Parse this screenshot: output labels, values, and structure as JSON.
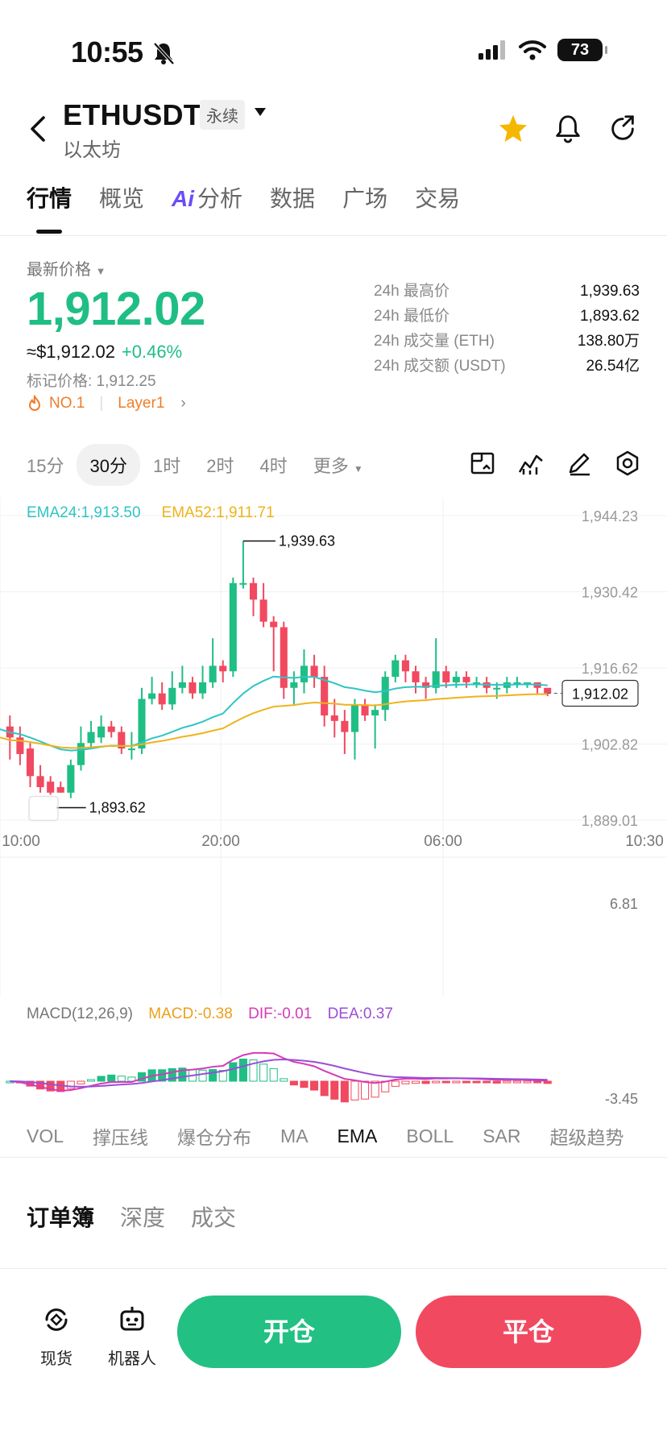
{
  "status": {
    "time": "10:55",
    "battery": "73"
  },
  "header": {
    "symbol": "ETHUSDT",
    "contract_type": "永续",
    "name": "以太坊"
  },
  "tabs": [
    "行情",
    "概览",
    "分析",
    "数据",
    "广场",
    "交易"
  ],
  "ai_badge": "Ai",
  "price": {
    "label": "最新价格",
    "last": "1,912.02",
    "usd": "≈$1,912.02",
    "change": "+0.46%",
    "mark_price": "标记价格: 1,912.25",
    "rank": "NO.1",
    "tag": "Layer1"
  },
  "stats": [
    {
      "label": "24h 最高价",
      "value": "1,939.63"
    },
    {
      "label": "24h 最低价",
      "value": "1,893.62"
    },
    {
      "label": "24h 成交量 (ETH)",
      "value": "138.80万"
    },
    {
      "label": "24h 成交额 (USDT)",
      "value": "26.54亿"
    }
  ],
  "timeframes": [
    "15分",
    "30分",
    "1时",
    "2时",
    "4时",
    "更多"
  ],
  "active_timeframe": "30分",
  "chart": {
    "ema24_label": "EMA24:1,913.50",
    "ema52_label": "EMA52:1,911.71",
    "y_ticks": [
      "1,944.23",
      "1,930.42",
      "1,916.62",
      "1,902.82",
      "1,889.01"
    ],
    "x_ticks": [
      "10:00",
      "20:00",
      "06:00",
      "10:30"
    ],
    "high_label": "1,939.63",
    "low_label": "1,893.62",
    "last_label": "1,912.02",
    "macd_params": "MACD(12,26,9)",
    "macd_value": "MACD:-0.38",
    "dif_value": "DIF:-0.01",
    "dea_value": "DEA:0.37",
    "macd_top": "6.81",
    "macd_bottom": "-3.45",
    "colors": {
      "up": "#1fbe85",
      "down": "#f1495f",
      "ema24": "#2ec5c4",
      "ema52": "#efb31b",
      "dif": "#d63ab8",
      "dea": "#9b4ed6"
    }
  },
  "chart_data": {
    "type": "candlestick",
    "ylim": [
      1889.01,
      1944.23
    ],
    "candles": [
      [
        1906,
        1904,
        1908,
        1900
      ],
      [
        1904,
        1901,
        1906,
        1899
      ],
      [
        1902,
        1897,
        1903,
        1895
      ],
      [
        1897,
        1895,
        1899,
        1894
      ],
      [
        1896,
        1894,
        1897,
        1893.62
      ],
      [
        1895,
        1894,
        1896,
        1894
      ],
      [
        1894,
        1899,
        1900,
        1893
      ],
      [
        1899,
        1903,
        1906,
        1898
      ],
      [
        1903,
        1905,
        1907,
        1902
      ],
      [
        1904,
        1906,
        1908,
        1903
      ],
      [
        1906,
        1905,
        1907,
        1904
      ],
      [
        1905,
        1902,
        1906,
        1901
      ],
      [
        1902,
        1902,
        1905,
        1900
      ],
      [
        1902,
        1911,
        1913,
        1901
      ],
      [
        1911,
        1912,
        1915,
        1910
      ],
      [
        1912,
        1910,
        1914,
        1909
      ],
      [
        1910,
        1913,
        1916,
        1909
      ],
      [
        1913,
        1914,
        1917,
        1912
      ],
      [
        1914,
        1912,
        1915,
        1911
      ],
      [
        1912,
        1914,
        1917,
        1911
      ],
      [
        1914,
        1917,
        1922,
        1913
      ],
      [
        1917,
        1916,
        1918,
        1914
      ],
      [
        1916,
        1932,
        1933,
        1915
      ],
      [
        1932,
        1932,
        1939.63,
        1931
      ],
      [
        1932,
        1929,
        1933,
        1926
      ],
      [
        1929,
        1925,
        1932,
        1924
      ],
      [
        1925,
        1924,
        1926,
        1916
      ],
      [
        1924,
        1913,
        1925,
        1911
      ],
      [
        1913,
        1914,
        1916,
        1910
      ],
      [
        1914,
        1917,
        1920,
        1912
      ],
      [
        1917,
        1915,
        1919,
        1913
      ],
      [
        1915,
        1908,
        1917,
        1906
      ],
      [
        1908,
        1907,
        1911,
        1904
      ],
      [
        1907,
        1905,
        1909,
        1901
      ],
      [
        1905,
        1910,
        1911,
        1900
      ],
      [
        1910,
        1908,
        1911,
        1907
      ],
      [
        1908,
        1909,
        1910,
        1902
      ],
      [
        1909,
        1915,
        1916,
        1907
      ],
      [
        1915,
        1918,
        1919,
        1914
      ],
      [
        1918,
        1916,
        1919,
        1914
      ],
      [
        1916,
        1914,
        1917,
        1912
      ],
      [
        1914,
        1913,
        1915,
        1911
      ],
      [
        1913,
        1916,
        1922,
        1912
      ],
      [
        1916,
        1914,
        1917,
        1913
      ],
      [
        1914,
        1915,
        1916,
        1913
      ],
      [
        1915,
        1914,
        1916,
        1913
      ],
      [
        1914,
        1914,
        1915,
        1913
      ],
      [
        1914,
        1913,
        1915,
        1912
      ],
      [
        1913,
        1913,
        1914,
        1911
      ],
      [
        1913,
        1914,
        1915,
        1912
      ],
      [
        1914,
        1914,
        1915,
        1913
      ],
      [
        1914,
        1914,
        1914,
        1913
      ],
      [
        1914,
        1913,
        1914,
        1912
      ],
      [
        1913,
        1912.02,
        1913,
        1911.5
      ]
    ],
    "macd_ylim": [
      -3.45,
      6.81
    ]
  },
  "indicators": [
    "VOL",
    "撑压线",
    "爆仓分布",
    "MA",
    "EMA",
    "BOLL",
    "SAR",
    "超级趋势"
  ],
  "active_indicator": "EMA",
  "book_tabs": [
    "订单簿",
    "深度",
    "成交"
  ],
  "bottom": {
    "spot": "现货",
    "bot": "机器人",
    "open": "开仓",
    "close": "平仓"
  }
}
